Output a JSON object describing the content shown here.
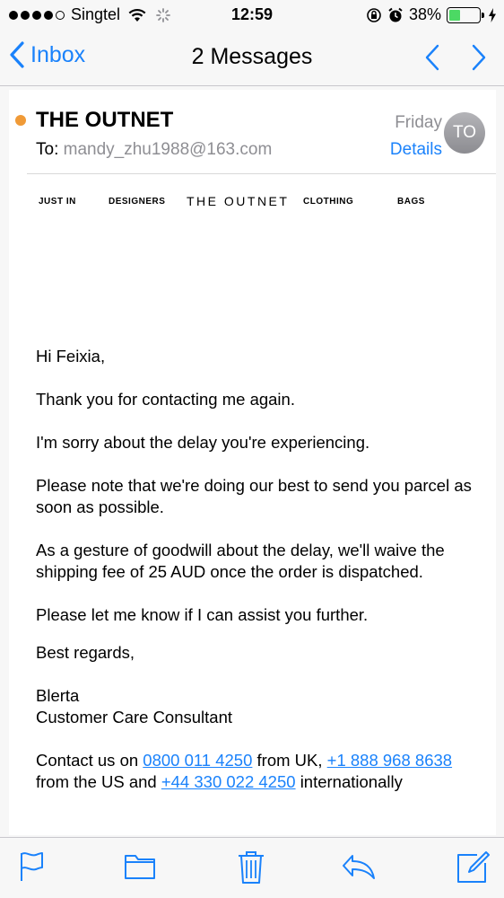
{
  "status_bar": {
    "carrier": "Singtel",
    "time": "12:59",
    "battery_percent": "38%",
    "battery_level": 0.38,
    "signal_bars_filled": 4,
    "signal_bars_total": 5,
    "icons": [
      "wifi-icon",
      "loading-icon",
      "orientation-lock-icon",
      "alarm-icon",
      "battery-icon",
      "charging-icon"
    ]
  },
  "nav": {
    "back_label": "Inbox",
    "title": "2 Messages",
    "accent_color": "#1a82fb"
  },
  "message": {
    "sender": "THE OUTNET",
    "to_label": "To:",
    "to_address": "mandy_zhu1988@163.com",
    "date": "Friday",
    "details_label": "Details",
    "avatar_initials": "TO",
    "unread_color": "#f09a37"
  },
  "brand_nav": {
    "just_in": "JUST IN",
    "designers": "DESIGNERS",
    "logo": "THE OUTNET",
    "clothing": "CLOTHING",
    "bags": "BAGS"
  },
  "body": {
    "greeting": "Hi Feixia,",
    "p1": "Thank you for contacting me again.",
    "p2": "I'm sorry about the delay you're experiencing.",
    "p3": "Please note that we're doing our best to send you parcel as soon as possible.",
    "p4": "As a gesture of goodwill about the delay, we'll waive the shipping fee of 25 AUD once the order is dispatched.",
    "p5": "Please let me know if I can assist you further.",
    "closing": "Best regards,",
    "signature_name": "Blerta",
    "signature_title": "Customer Care Consultant",
    "contact_prefix": "Contact us on",
    "phone_uk": "0800 011 4250",
    "contact_mid1": "from UK,",
    "phone_us": "+1 888 968 8638",
    "contact_mid2": "from the US and",
    "phone_intl": "+44 330 022 4250",
    "contact_suffix": "internationally"
  },
  "toolbar": {
    "icons": [
      "flag-icon",
      "folder-icon",
      "trash-icon",
      "reply-icon",
      "compose-icon"
    ]
  }
}
